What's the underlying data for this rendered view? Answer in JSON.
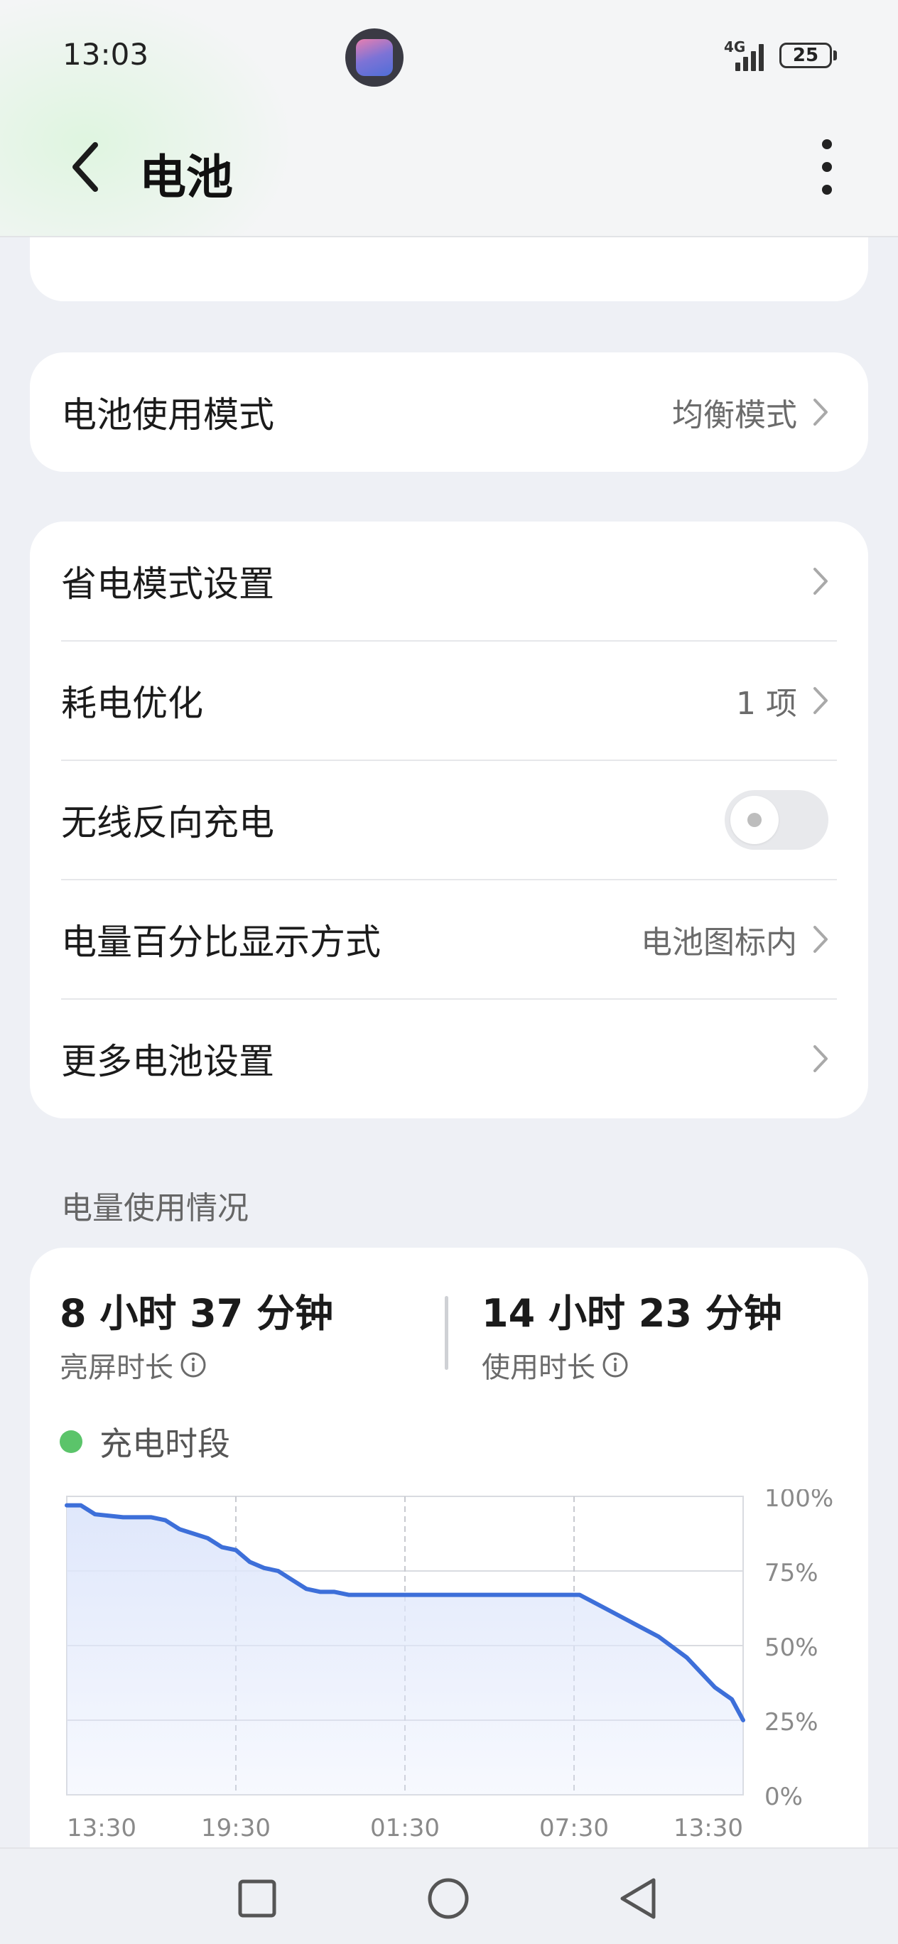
{
  "status_bar": {
    "time": "13:03",
    "network": "4G",
    "battery_level": "25"
  },
  "header": {
    "title": "电池"
  },
  "battery_progress": {
    "fill_fraction": 0.25,
    "color": "#5bc46a"
  },
  "mode_card": {
    "label": "电池使用模式",
    "value": "均衡模式"
  },
  "settings": {
    "power_saving": {
      "label": "省电模式设置"
    },
    "optimization": {
      "label": "耗电优化",
      "value": "1 项"
    },
    "reverse_charging": {
      "label": "无线反向充电",
      "enabled": false
    },
    "percentage_display": {
      "label": "电量百分比显示方式",
      "value": "电池图标内"
    },
    "more": {
      "label": "更多电池设置"
    }
  },
  "usage": {
    "section_title": "电量使用情况",
    "screen_on_value": "8 小时 37 分钟",
    "screen_on_label": "亮屏时长",
    "usage_value": "14 小时 23 分钟",
    "usage_label": "使用时长",
    "legend_label": "充电时段"
  },
  "chart_data": {
    "type": "area",
    "title": "",
    "xlabel": "",
    "ylabel": "",
    "x_ticks": [
      "13:30",
      "19:30",
      "01:30",
      "07:30",
      "13:30"
    ],
    "y_ticks": [
      "100%",
      "75%",
      "50%",
      "25%",
      "0%"
    ],
    "ylim": [
      0,
      100
    ],
    "x_hours": [
      0,
      0.5,
      1,
      2,
      3,
      3.5,
      4,
      5,
      5.5,
      6,
      6.5,
      7,
      7.5,
      8,
      8.5,
      9,
      9.5,
      10,
      12,
      14,
      16,
      18,
      18.2,
      19,
      20,
      21,
      22,
      22.5,
      23,
      23.6,
      24
    ],
    "values": [
      97,
      97,
      94,
      93,
      93,
      92,
      89,
      86,
      83,
      82,
      78,
      76,
      75,
      72,
      69,
      68,
      68,
      67,
      67,
      67,
      67,
      67,
      67,
      63,
      58,
      53,
      46,
      41,
      36,
      32,
      25
    ],
    "grid": true,
    "line_color": "#3d6fd9",
    "fill_color": "#dfe7fb"
  }
}
